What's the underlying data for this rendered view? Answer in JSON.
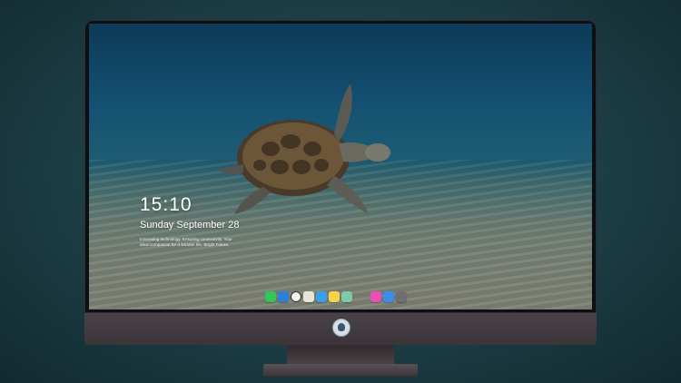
{
  "lock_screen": {
    "time": "15:10",
    "date": "Sunday September 28",
    "tagline": "Innovating technology, Ensuring connectivity. Your ideal companion for a smarter life. Bright Future."
  },
  "dock": {
    "icons": [
      {
        "name": "messages-icon",
        "color": "#33c759"
      },
      {
        "name": "finder-icon",
        "color": "#2f7fd8"
      },
      {
        "name": "clock-icon",
        "color": "#f2f2f2"
      },
      {
        "name": "photos-icon",
        "color": "#e9e4d8"
      },
      {
        "name": "video-icon",
        "color": "#3aa0e8"
      },
      {
        "name": "notes-icon",
        "color": "#f6d34a"
      },
      {
        "name": "maps-icon",
        "color": "#7fc8a8"
      },
      {
        "name": "music-icon",
        "color": "#e94fb7"
      },
      {
        "name": "safari-icon",
        "color": "#3b8ee8"
      },
      {
        "name": "camera-icon",
        "color": "#6f6f73"
      }
    ]
  }
}
